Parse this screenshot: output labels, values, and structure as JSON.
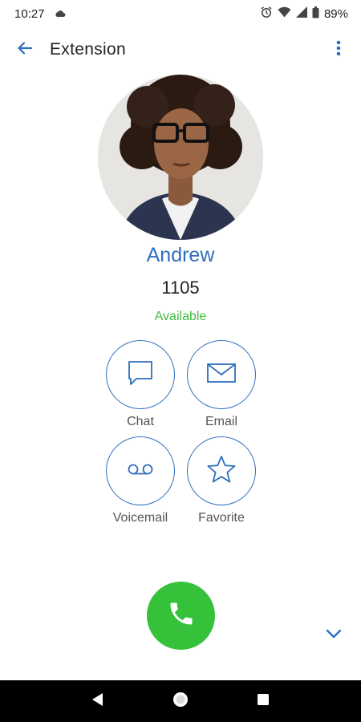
{
  "status_bar": {
    "time": "10:27",
    "battery": "89%",
    "icons": [
      "cloud-icon",
      "alarm-icon",
      "wifi-icon",
      "signal-icon",
      "battery-icon"
    ]
  },
  "app_bar": {
    "title": "Extension",
    "back_icon": "arrow-left-icon",
    "menu_icon": "more-vert-icon"
  },
  "contact": {
    "name": "Andrew",
    "extension": "1105",
    "status": "Available"
  },
  "actions": {
    "chat": "Chat",
    "email": "Email",
    "voicemail": "Voicemail",
    "favorite": "Favorite"
  },
  "colors": {
    "accent": "#2f6fbe",
    "available": "#3fbf3f",
    "call": "#35c13a"
  }
}
